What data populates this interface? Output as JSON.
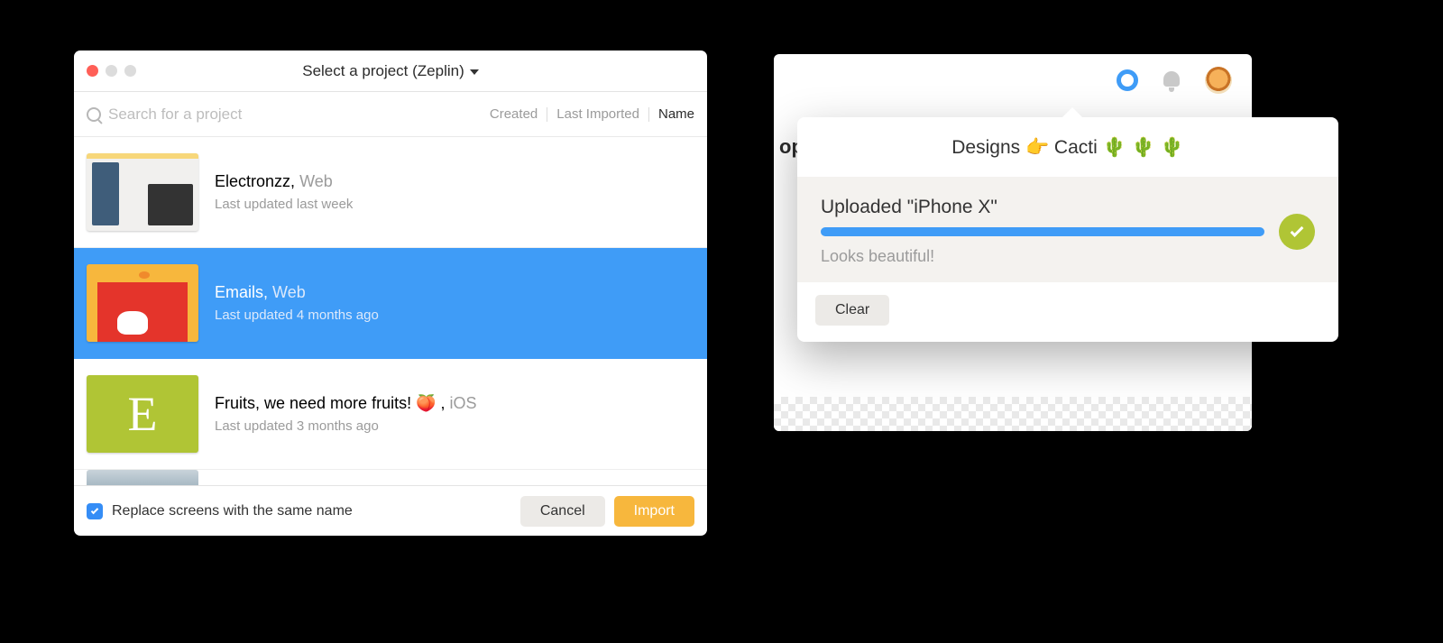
{
  "left": {
    "title": "Select a project (Zeplin)",
    "search": {
      "placeholder": "Search for a project"
    },
    "sorts": {
      "created": "Created",
      "lastImported": "Last Imported",
      "name": "Name"
    },
    "projects": [
      {
        "name": "Electronzz,",
        "platform": "Web",
        "sub": "Last updated last week"
      },
      {
        "name": "Emails,",
        "platform": "Web",
        "sub": "Last updated 4 months ago"
      },
      {
        "name": "Fruits, we need more fruits! 🍑 ,",
        "platform": "iOS",
        "sub": "Last updated 3 months ago"
      }
    ],
    "thumbLetter": "E",
    "replaceLabel": "Replace screens with the same name",
    "cancel": "Cancel",
    "import": "Import"
  },
  "right": {
    "partialText": "op",
    "popTitle": "Designs 👉 Cacti 🌵 🌵 🌵",
    "uploadTitle": "Uploaded \"iPhone X\"",
    "uploadSub": "Looks beautiful!",
    "clear": "Clear"
  }
}
